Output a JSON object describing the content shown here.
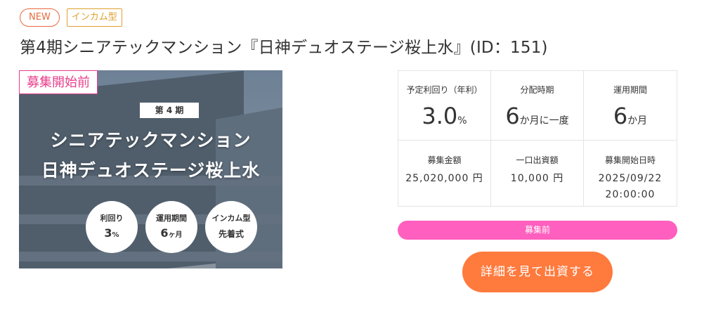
{
  "badges": {
    "new": "NEW",
    "type": "インカム型"
  },
  "title": "第4期シニアテックマンション『日神デュオステージ桜上水』(ID：151)",
  "hero": {
    "status": "募集開始前",
    "period": "第 4 期",
    "line1": "シニアテックマンション",
    "line2": "日神デュオステージ桜上水",
    "circles": [
      {
        "top": "利回り",
        "value": "3",
        "unit": "%"
      },
      {
        "top": "運用期間",
        "value": "6",
        "unit": "ヶ月"
      },
      {
        "top": "インカム型",
        "value": "先着式",
        "unit": ""
      }
    ]
  },
  "info": {
    "yield_label": "予定利回り（年利）",
    "yield_value": "3.0",
    "yield_unit": "%",
    "dist_label": "分配時期",
    "dist_value": "6",
    "dist_unit": "か月に一度",
    "term_label": "運用期間",
    "term_value": "6",
    "term_unit": "か月",
    "amount_label": "募集金額",
    "amount_value": "25,020,000 円",
    "unit_label": "一口出資額",
    "unit_value": "10,000 円",
    "start_label": "募集開始日時",
    "start_date": "2025/09/22",
    "start_time": "20:00:00"
  },
  "status_bar": "募集前",
  "cta": "詳細を見て出資する"
}
